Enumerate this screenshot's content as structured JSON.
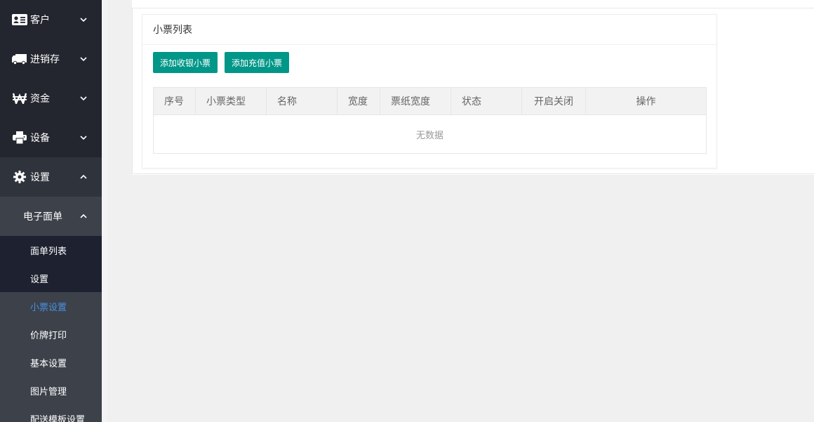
{
  "sidebar": {
    "items": [
      {
        "label": "客户",
        "icon": "id-card-icon"
      },
      {
        "label": "进销存",
        "icon": "truck-icon"
      },
      {
        "label": "资金",
        "icon": "won-icon"
      },
      {
        "label": "设备",
        "icon": "printer-icon"
      },
      {
        "label": "设置",
        "icon": "gear-icon"
      }
    ],
    "subgroup": {
      "label": "电子面单"
    },
    "subitems": [
      {
        "label": "面单列表"
      },
      {
        "label": "设置"
      },
      {
        "label": "小票设置"
      },
      {
        "label": "价牌打印"
      },
      {
        "label": "基本设置"
      },
      {
        "label": "图片管理"
      },
      {
        "label": "配送模板设置"
      }
    ],
    "active_color": "#4a90e2"
  },
  "card": {
    "title": "小票列表",
    "buttons": {
      "add_receipt": "添加收银小票",
      "add_recharge": "添加充值小票"
    },
    "button_color": "#009688"
  },
  "table": {
    "headers": [
      "序号",
      "小票类型",
      "名称",
      "宽度",
      "票纸宽度",
      "状态",
      "开启关闭",
      "操作"
    ],
    "empty_text": "无数据"
  }
}
